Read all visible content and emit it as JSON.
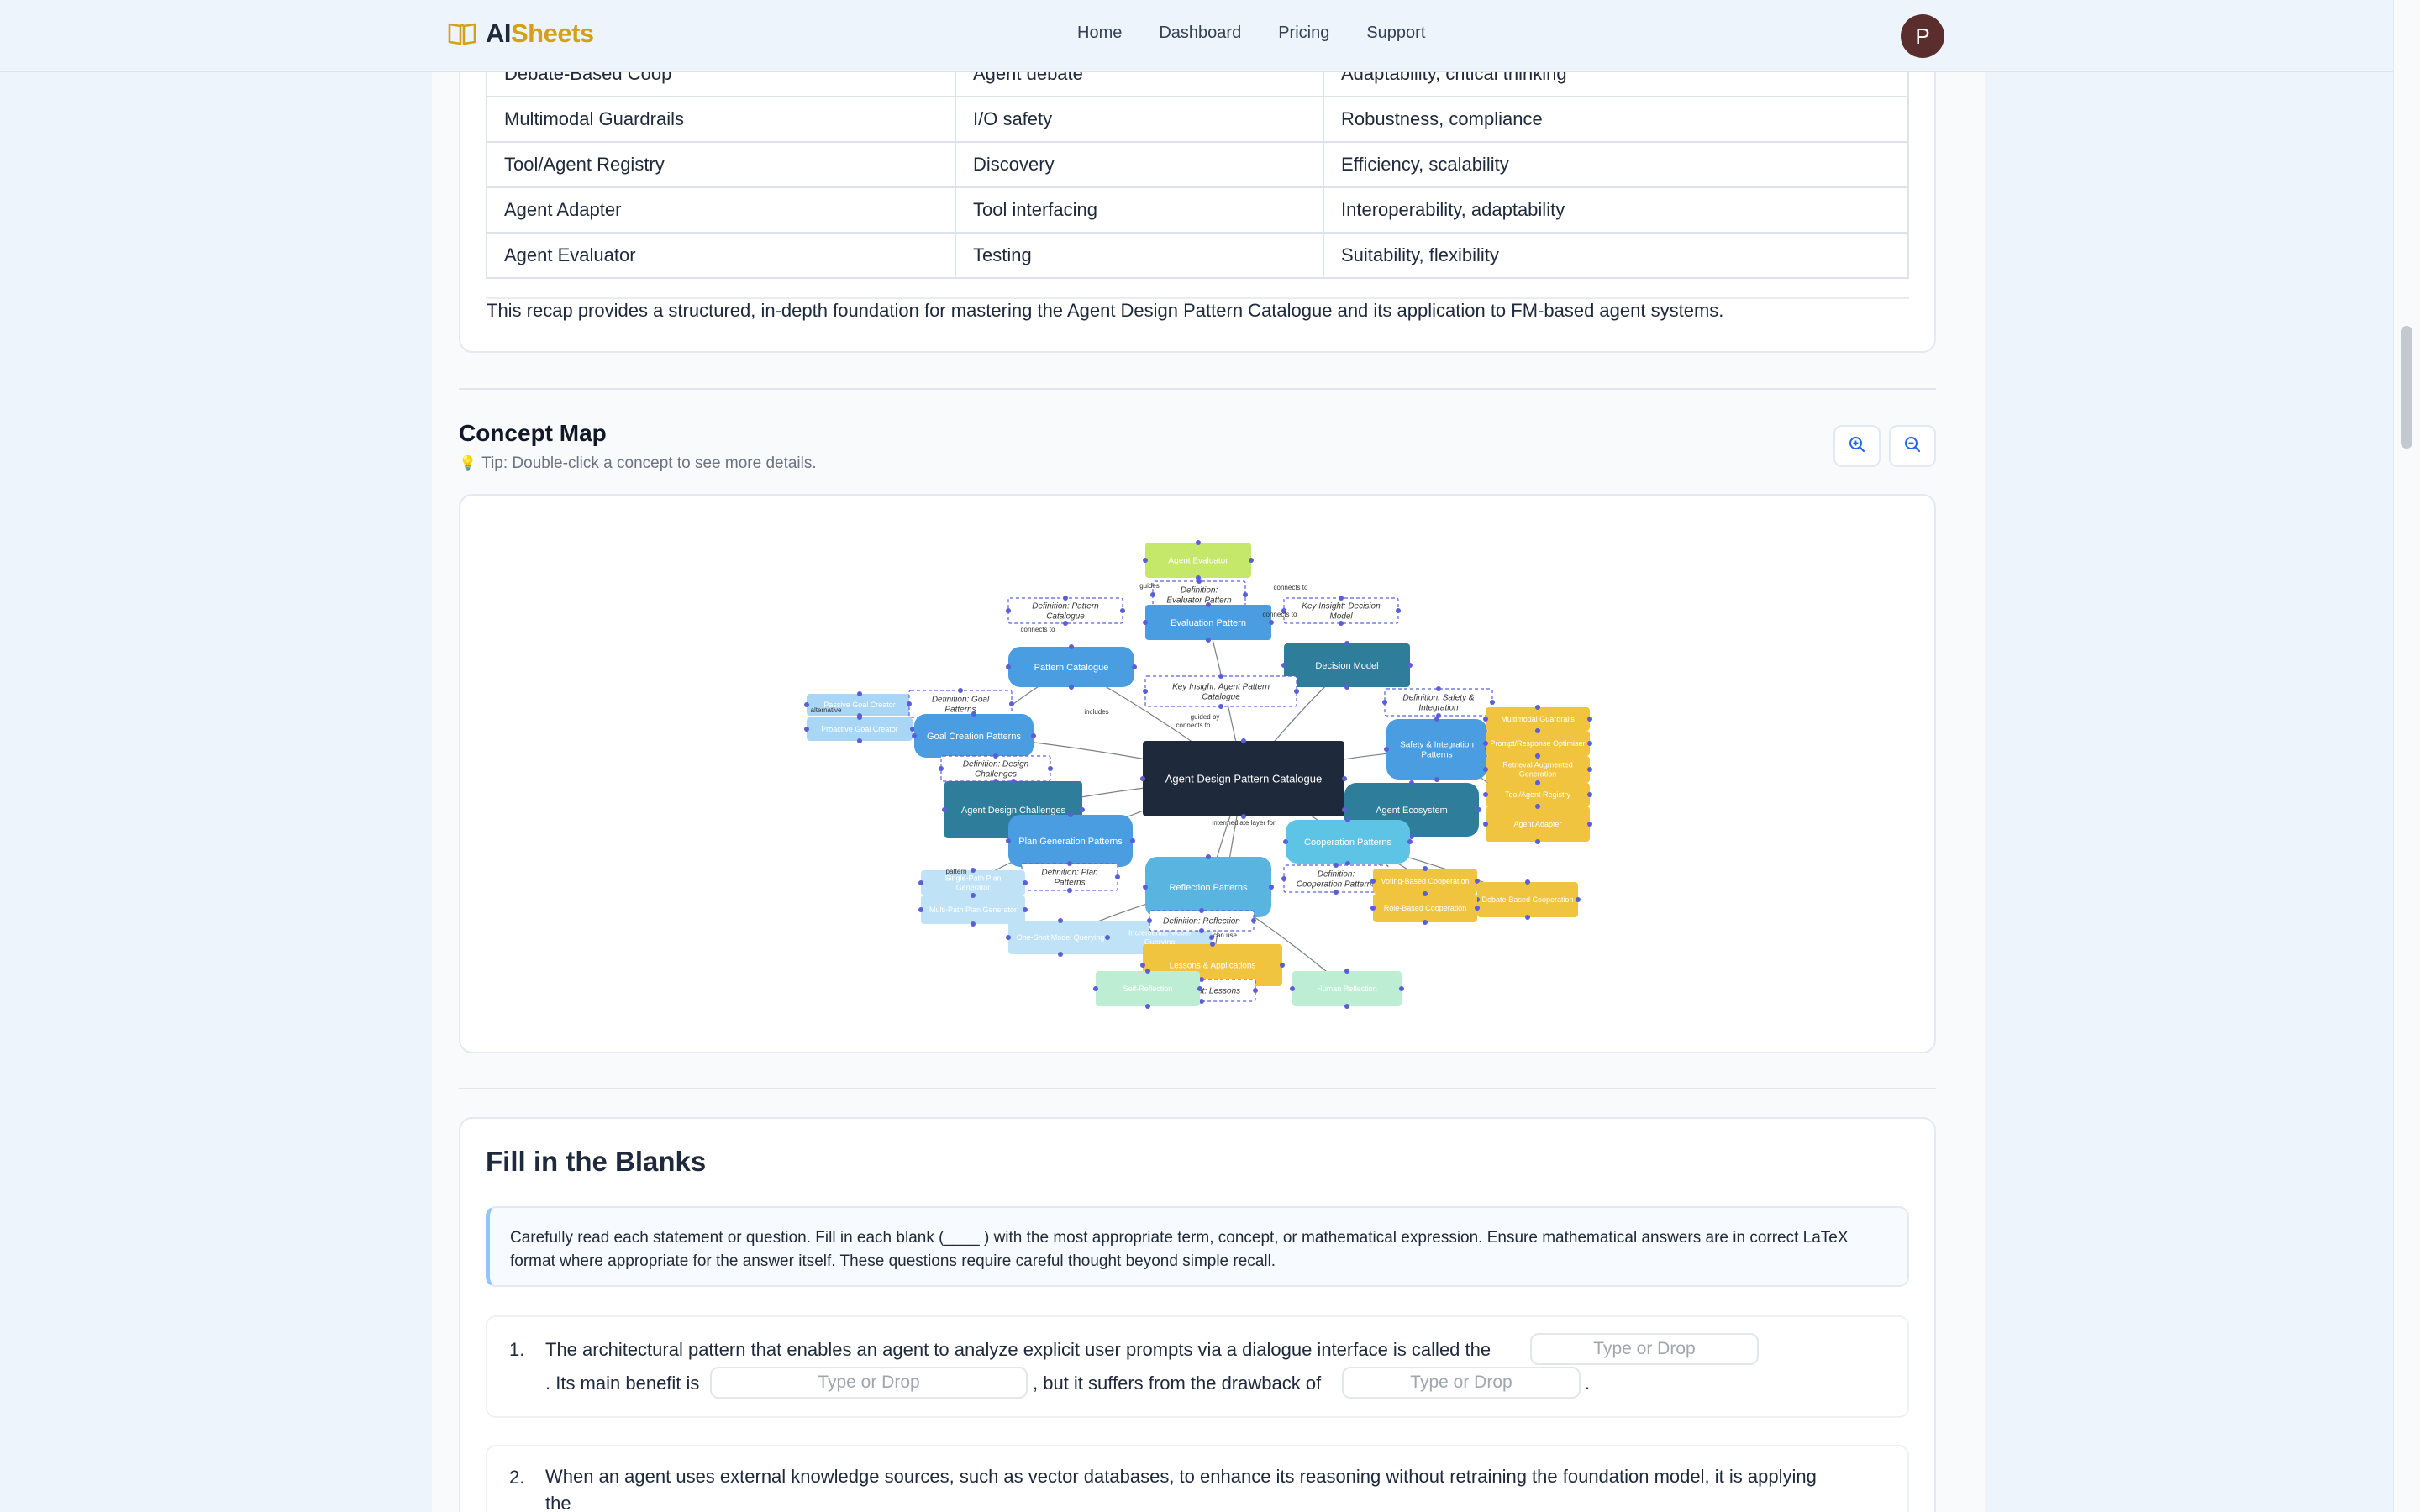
{
  "brand": {
    "part1": "AI",
    "part2": "Sheets",
    "icon": "open-book-icon"
  },
  "nav": {
    "home": "Home",
    "dashboard": "Dashboard",
    "pricing": "Pricing",
    "support": "Support"
  },
  "avatar": {
    "initial": "P"
  },
  "recap_table": {
    "rows": [
      [
        "Debate-Based Coop",
        "Agent debate",
        "Adaptability, critical thinking"
      ],
      [
        "Multimodal Guardrails",
        "I/O safety",
        "Robustness, compliance"
      ],
      [
        "Tool/Agent Registry",
        "Discovery",
        "Efficiency, scalability"
      ],
      [
        "Agent Adapter",
        "Tool interfacing",
        "Interoperability, adaptability"
      ],
      [
        "Agent Evaluator",
        "Testing",
        "Suitability, flexibility"
      ]
    ],
    "summary": "This recap provides a structured, in-depth foundation for mastering the Agent Design Pattern Catalogue and its application to FM-based agent systems."
  },
  "concept_map": {
    "title": "Concept Map",
    "tip": "Tip: Double-click a concept to see more details.",
    "zoom_in_icon": "zoom-in-icon",
    "zoom_out_icon": "zoom-out-icon",
    "nodes": {
      "center": "Agent Design Pattern Catalogue",
      "agent_evaluator": "Agent Evaluator",
      "def_evaluator": "Definition: Evaluator Pattern",
      "evaluation_pattern": "Evaluation Pattern",
      "def_pattern_catalogue": "Definition: Pattern Catalogue",
      "key_decision": "Key Insight: Decision Model",
      "pattern_catalogue": "Pattern Catalogue",
      "decision_model": "Decision Model",
      "key_agent_pattern": "Key Insight: Agent Pattern Catalogue",
      "def_safety": "Definition: Safety & Integration",
      "passive_goal": "Passive Goal Creator",
      "def_goal": "Definition: Goal Patterns",
      "proactive_goal": "Proactive Goal Creator",
      "goal_creation": "Goal Creation Patterns",
      "def_design_challenges": "Definition: Design Challenges",
      "safety_integration": "Safety & Integration Patterns",
      "multimodal_guardrails": "Multimodal Guardrails",
      "prompt_response": "Prompt/Response Optimiser",
      "rag": "Retrieval Augmented Generation",
      "tool_registry": "Tool/Agent Registry",
      "agent_adapter": "Agent Adapter",
      "agent_design_challenges": "Agent Design Challenges",
      "agent_ecosystem": "Agent Ecosystem",
      "plan_generation": "Plan Generation Patterns",
      "cooperation_patterns": "Cooperation Patterns",
      "def_plan": "Definition: Plan Patterns",
      "reflection_patterns": "Reflection Patterns",
      "def_cooperation": "Definition: Cooperation Patterns",
      "voting_coop": "Voting-Based Cooperation",
      "debate_coop": "Debate-Based Cooperation",
      "role_coop": "Role-Based Cooperation",
      "single_path": "Single-Path Plan Generator",
      "multi_path": "Multi-Path Plan Generator",
      "one_shot": "One-Shot Model Querying",
      "incremental": "Incremental Model Querying",
      "def_reflection": "Definition: Reflection",
      "lessons": "Lessons & Applications",
      "key_lessons": "Key Insight: Lessons",
      "self_reflection": "Self-Reflection",
      "human_reflection": "Human Reflection"
    },
    "edge_labels": {
      "connects_to": "connects to",
      "includes": "includes",
      "guided_by": "guided by",
      "intermediate": "intermediate layer for",
      "alternative": "alternative",
      "pattern": "pattern",
      "guides": "guides",
      "can_use": "can use"
    }
  },
  "fill_blanks": {
    "title": "Fill in the Blanks",
    "instructions": "Carefully read each statement or question. Fill in each blank (____ ) with the most appropriate term, concept, or mathematical expression. Ensure mathematical answers are in correct LaTeX format where appropriate for the answer itself. These questions require careful thought beyond simple recall.",
    "blank_placeholder": "Type or Drop",
    "q1": {
      "num": "1.",
      "part1": "The architectural pattern that enables an agent to analyze explicit user prompts via a dialogue interface is called the",
      "part2": ". Its main benefit is",
      "part3": ", but it suffers from the drawback of",
      "part4": "."
    },
    "q2": {
      "num": "2.",
      "part1": "When an agent uses external knowledge sources, such as vector databases, to enhance its reasoning without retraining the foundation model, it is applying",
      "part2": "the"
    }
  },
  "colors": {
    "brand_gold": "#d4a017",
    "center_node": "#1e293b",
    "blue_node": "#4a9de0",
    "teal_node": "#2e7d9a",
    "gold_node": "#f0c43f",
    "light_blue": "#a9d6f5",
    "green_node": "#c6e86a",
    "mint_node": "#bdeed3"
  }
}
